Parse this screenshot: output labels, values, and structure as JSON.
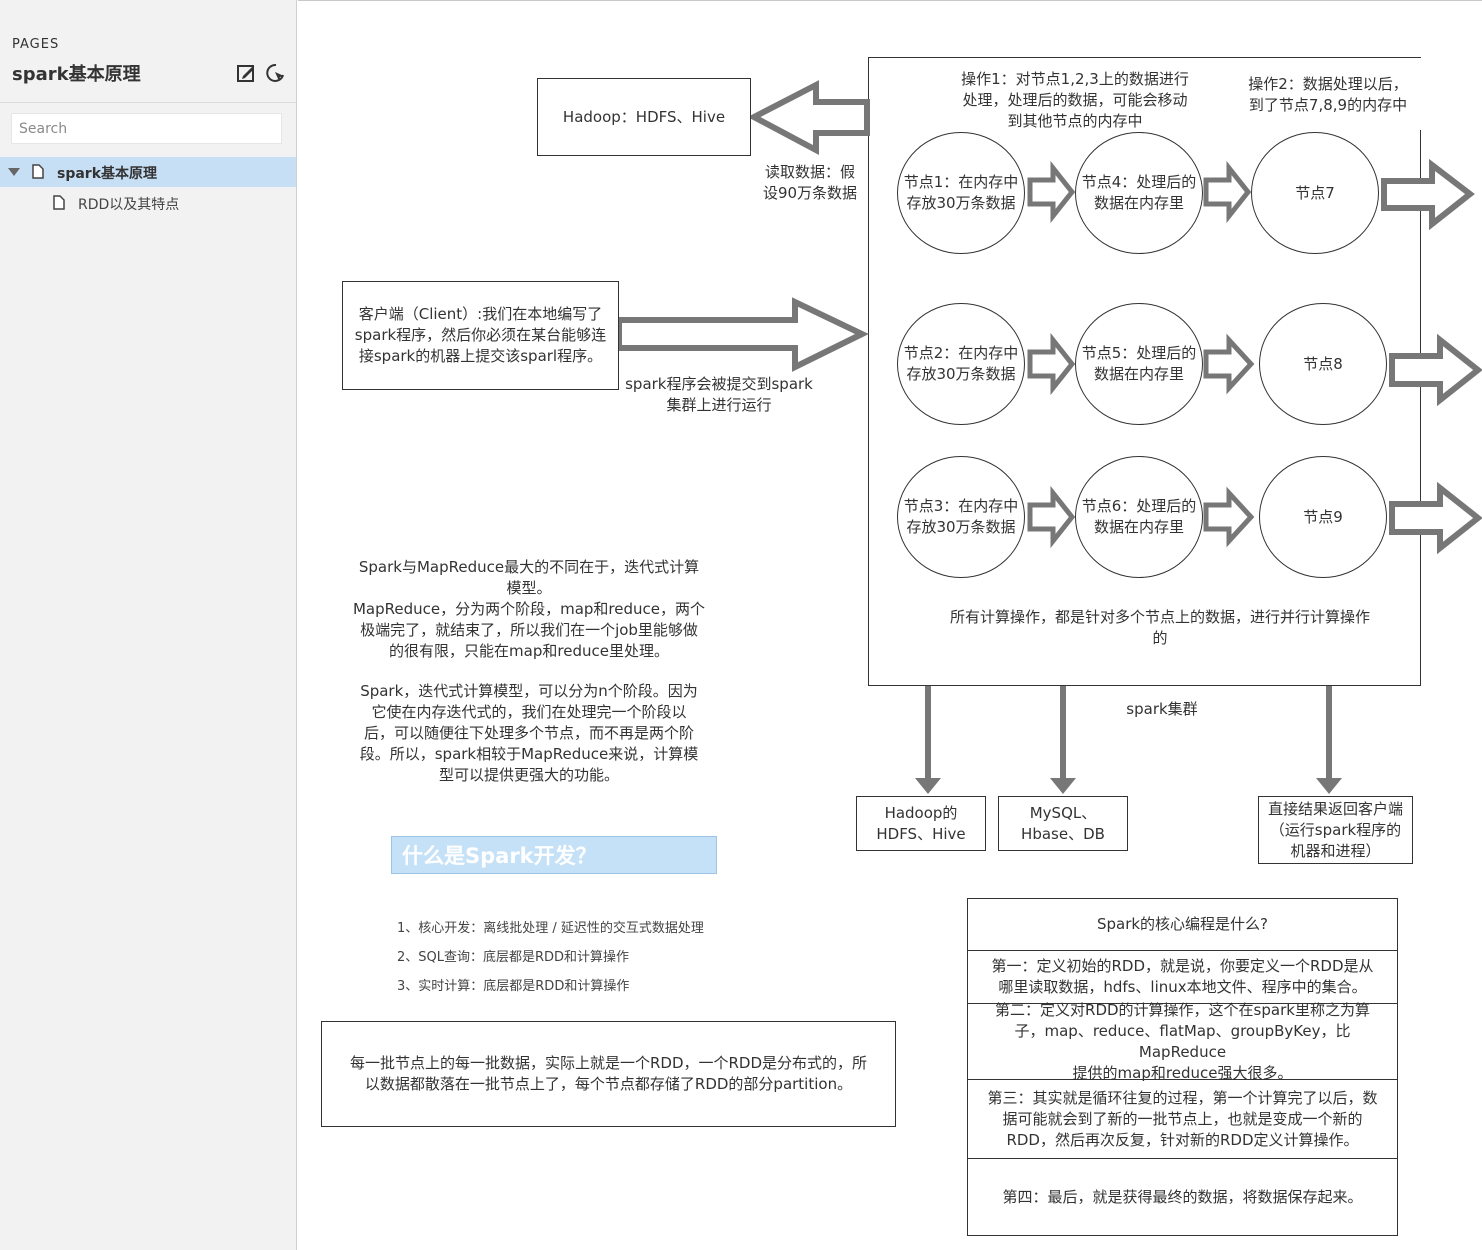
{
  "sidebar": {
    "pages_label": "PAGES",
    "title": "spark基本原理",
    "search_placeholder": "Search",
    "tree": [
      {
        "label": "spark基本原理",
        "selected": true
      },
      {
        "label": "RDD以及其特点",
        "selected": false
      }
    ],
    "icons": [
      "edit-page-icon",
      "add-page-icon"
    ]
  },
  "diagram": {
    "hadoop_source": "Hadoop：HDFS、Hive",
    "read_note": [
      "读取数据：假",
      "设90万条数据"
    ],
    "client_box": [
      "客户端（Client）:我们在本地编写了",
      "spark程序，然后你必须在某台能够连",
      "接spark的机器上提交该sparl程序。"
    ],
    "submit_note": [
      "spark程序会被提交到spark",
      "集群上进行运行"
    ],
    "op1": [
      "操作1：对节点1,2,3上的数据进行",
      "处理，处理后的数据，可能会移动",
      "到其他节点的内存中"
    ],
    "op2": [
      "操作2：数据处理以后，",
      "到了节点7,8,9的内存中"
    ],
    "nodes": [
      [
        "节点1：在内存中",
        "存放30万条数据"
      ],
      [
        "节点4：处理后的",
        "数据在内存里"
      ],
      [
        "节点7"
      ],
      [
        "节点2：在内存中",
        "存放30万条数据"
      ],
      [
        "节点5：处理后的",
        "数据在内存里"
      ],
      [
        "节点8"
      ],
      [
        "节点3：在内存中",
        "存放30万条数据"
      ],
      [
        "节点6：处理后的",
        "数据在内存里"
      ],
      [
        "节点9"
      ]
    ],
    "parallel_note": [
      "所有计算操作，都是针对多个节点上的数据，进行并行计算操作",
      "的"
    ],
    "cluster_label": "spark集群",
    "outputs": [
      [
        "Hadoop的",
        "HDFS、Hive"
      ],
      [
        "MySQL、",
        "Hbase、DB"
      ],
      [
        "直接结果返回客户端",
        "（运行spark程序的",
        "机器和进程）"
      ]
    ],
    "mapreduce_text": [
      "Spark与MapReduce最大的不同在于，迭代式计算",
      "模型。",
      "MapReduce，分为两个阶段，map和reduce，两个",
      "极端完了，就结束了，所以我们在一个job里能够做",
      "的很有限，只能在map和reduce里处理。",
      "",
      "Spark，迭代式计算模型，可以分为n个阶段。因为",
      "它使在内存迭代式的，我们在处理完一个阶段以",
      "后，可以随便往下处理多个节点，而不再是两个阶",
      "段。所以，spark相较于MapReduce来说，计算模",
      "型可以提供更强大的功能。"
    ],
    "banner": "什么是Spark开发？",
    "dev_list": [
      "1、核心开发：离线批处理 / 延迟性的交互式数据处理",
      "2、SQL查询：底层都是RDD和计算操作",
      "3、实时计算：底层都是RDD和计算操作"
    ],
    "rdd_box": [
      "每一批节点上的每一批数据，实际上就是一个RDD，一个RDD是分布式的，所",
      "以数据都散落在一批节点上了，每个节点都存储了RDD的部分partition。"
    ],
    "core_title": "Spark的核心编程是什么?",
    "core_items": [
      [
        "第一：定义初始的RDD，就是说，你要定义一个RDD是从",
        "哪里读取数据，hdfs、linux本地文件、程序中的集合。"
      ],
      [
        "第二：定义对RDD的计算操作，这个在spark里称之为算",
        "子，map、reduce、flatMap、groupByKey，比MapReduce",
        "提供的map和reduce强大很多。"
      ],
      [
        "第三：其实就是循环往复的过程，第一个计算完了以后，数",
        "据可能就会到了新的一批节点上，也就是变成一个新的",
        "RDD，然后再次反复，针对新的RDD定义计算操作。"
      ],
      [
        "第四：最后，就是获得最终的数据，将数据保存起来。"
      ]
    ]
  }
}
